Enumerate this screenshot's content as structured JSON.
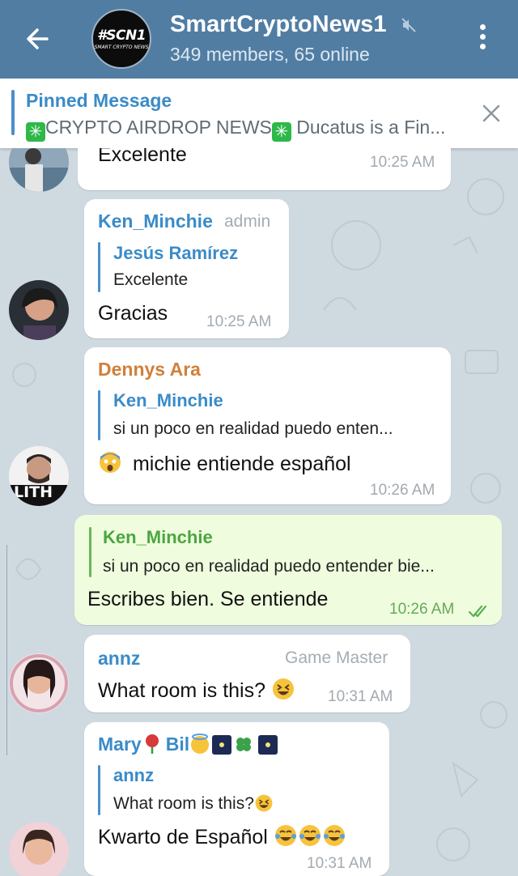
{
  "header": {
    "title": "SmartCryptoNews1",
    "subtitle": "349 members, 65 online",
    "logo_line1": "#SCN1",
    "logo_line2": "SMART CRYPTO NEWS",
    "colors": {
      "bar": "#517da2"
    }
  },
  "pinned": {
    "title": "Pinned Message",
    "text": "CRYPTO AIRDROP NEWS",
    "text_after": "Ducatus is a Fin..."
  },
  "messages": [
    {
      "text": "Excelente",
      "time": "10:25 AM"
    },
    {
      "sender": "Ken_Minchie",
      "role": "admin",
      "reply_name": "Jesús Ramírez",
      "reply_text": "Excelente",
      "text": "Gracias",
      "time": "10:25 AM"
    },
    {
      "sender": "Dennys Ara",
      "reply_name": "Ken_Minchie",
      "reply_text": "si un poco en realidad puedo enten...",
      "text": "michie entiende español",
      "time": "10:26 AM",
      "avatar_label": "LITH"
    },
    {
      "outgoing": true,
      "reply_name": "Ken_Minchie",
      "reply_text": "si un poco en realidad puedo entender bie...",
      "text": "Escribes bien. Se entiende",
      "time": "10:26 AM"
    },
    {
      "sender": "annz",
      "role": "Game Master",
      "text": "What room is this?",
      "time": "10:31 AM"
    },
    {
      "sender": "Mary",
      "sender_part2": "Bil",
      "reply_name": "annz",
      "reply_text": "What room is this?",
      "text": "Kwarto de Español",
      "time": "10:31 AM"
    }
  ],
  "colors": {
    "sender_blue": "#3a8bc8",
    "sender_orange": "#d0803a",
    "sender_green": "#4aa63f",
    "sender_pink": "#c9537a"
  }
}
